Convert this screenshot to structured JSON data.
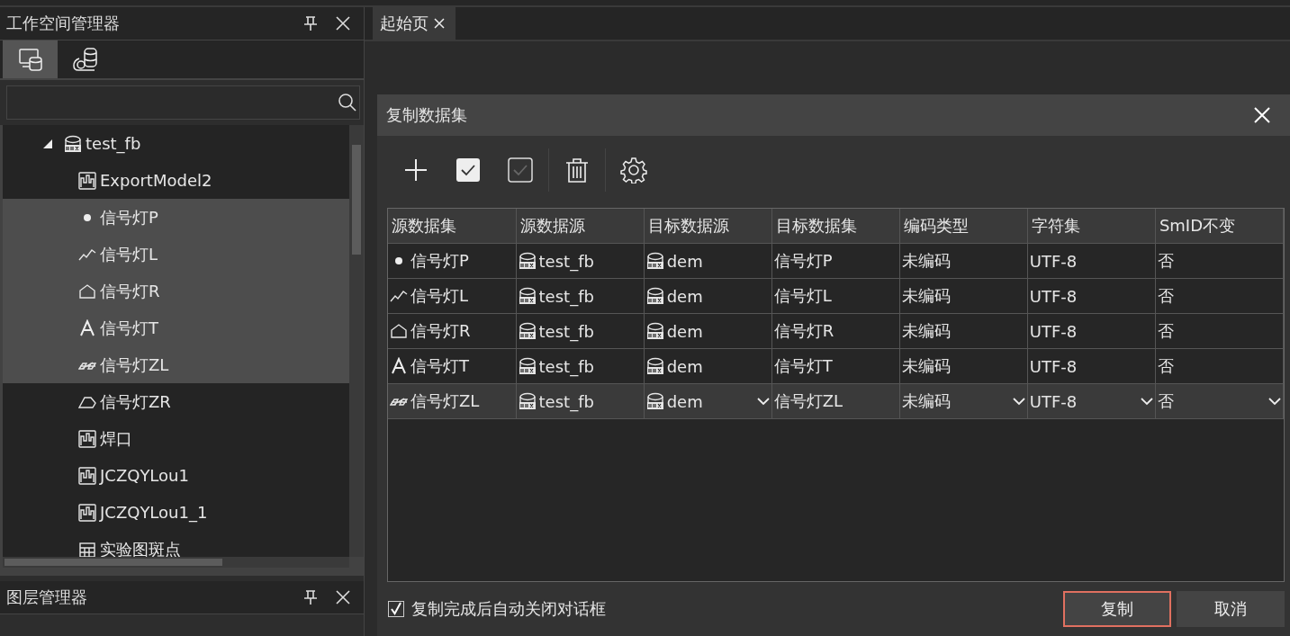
{
  "workspace_panel": {
    "title": "工作空间管理器",
    "tabs": [
      {
        "kind": "local",
        "selected": true
      },
      {
        "kind": "cloud",
        "selected": false
      }
    ],
    "tree": [
      {
        "label": "test_fb",
        "kind": "datasource",
        "expanded": true,
        "selected": false,
        "children": [
          {
            "label": "ExportModel2",
            "kind": "model",
            "selected": false
          },
          {
            "label": "信号灯P",
            "kind": "point",
            "selected": true
          },
          {
            "label": "信号灯L",
            "kind": "line",
            "selected": true
          },
          {
            "label": "信号灯R",
            "kind": "region",
            "selected": true
          },
          {
            "label": "信号灯T",
            "kind": "text",
            "selected": true
          },
          {
            "label": "信号灯ZL",
            "kind": "line3d",
            "selected": true
          },
          {
            "label": "信号灯ZR",
            "kind": "region3d",
            "selected": false
          },
          {
            "label": "焊口",
            "kind": "model",
            "selected": false
          },
          {
            "label": "JCZQYLou1",
            "kind": "model",
            "selected": false
          },
          {
            "label": "JCZQYLou1_1",
            "kind": "model",
            "selected": false
          },
          {
            "label": "实验图斑点",
            "kind": "tabular",
            "selected": false
          }
        ]
      }
    ]
  },
  "layer_panel": {
    "title": "图层管理器"
  },
  "doc_tabs": [
    {
      "label": "起始页",
      "selected": true
    }
  ],
  "dialog": {
    "title": "复制数据集",
    "toolbar": [
      {
        "kind": "add"
      },
      {
        "kind": "select_all"
      },
      {
        "kind": "invert"
      },
      {
        "kind": "delete"
      },
      {
        "kind": "settings"
      }
    ],
    "table": {
      "columns": [
        "源数据集",
        "源数据源",
        "目标数据源",
        "目标数据集",
        "编码类型",
        "字符集",
        "SmID不变"
      ],
      "rows": [
        {
          "kind": "point",
          "dataset": "信号灯P",
          "source": "test_fb",
          "target_source": "dem",
          "target_dataset": "信号灯P",
          "encoding": "未编码",
          "charset": "UTF-8",
          "keep_smid": "否",
          "editing": false
        },
        {
          "kind": "line",
          "dataset": "信号灯L",
          "source": "test_fb",
          "target_source": "dem",
          "target_dataset": "信号灯L",
          "encoding": "未编码",
          "charset": "UTF-8",
          "keep_smid": "否",
          "editing": false
        },
        {
          "kind": "region",
          "dataset": "信号灯R",
          "source": "test_fb",
          "target_source": "dem",
          "target_dataset": "信号灯R",
          "encoding": "未编码",
          "charset": "UTF-8",
          "keep_smid": "否",
          "editing": false
        },
        {
          "kind": "text",
          "dataset": "信号灯T",
          "source": "test_fb",
          "target_source": "dem",
          "target_dataset": "信号灯T",
          "encoding": "未编码",
          "charset": "UTF-8",
          "keep_smid": "否",
          "editing": false
        },
        {
          "kind": "line3d",
          "dataset": "信号灯ZL",
          "source": "test_fb",
          "target_source": "dem",
          "target_dataset": "信号灯ZL",
          "encoding": "未编码",
          "charset": "UTF-8",
          "keep_smid": "否",
          "editing": true
        }
      ]
    },
    "auto_close": {
      "label": "复制完成后自动关闭对话框",
      "checked": true
    },
    "buttons": [
      {
        "label": "复制",
        "default": true
      },
      {
        "label": "取消",
        "default": false
      }
    ]
  }
}
